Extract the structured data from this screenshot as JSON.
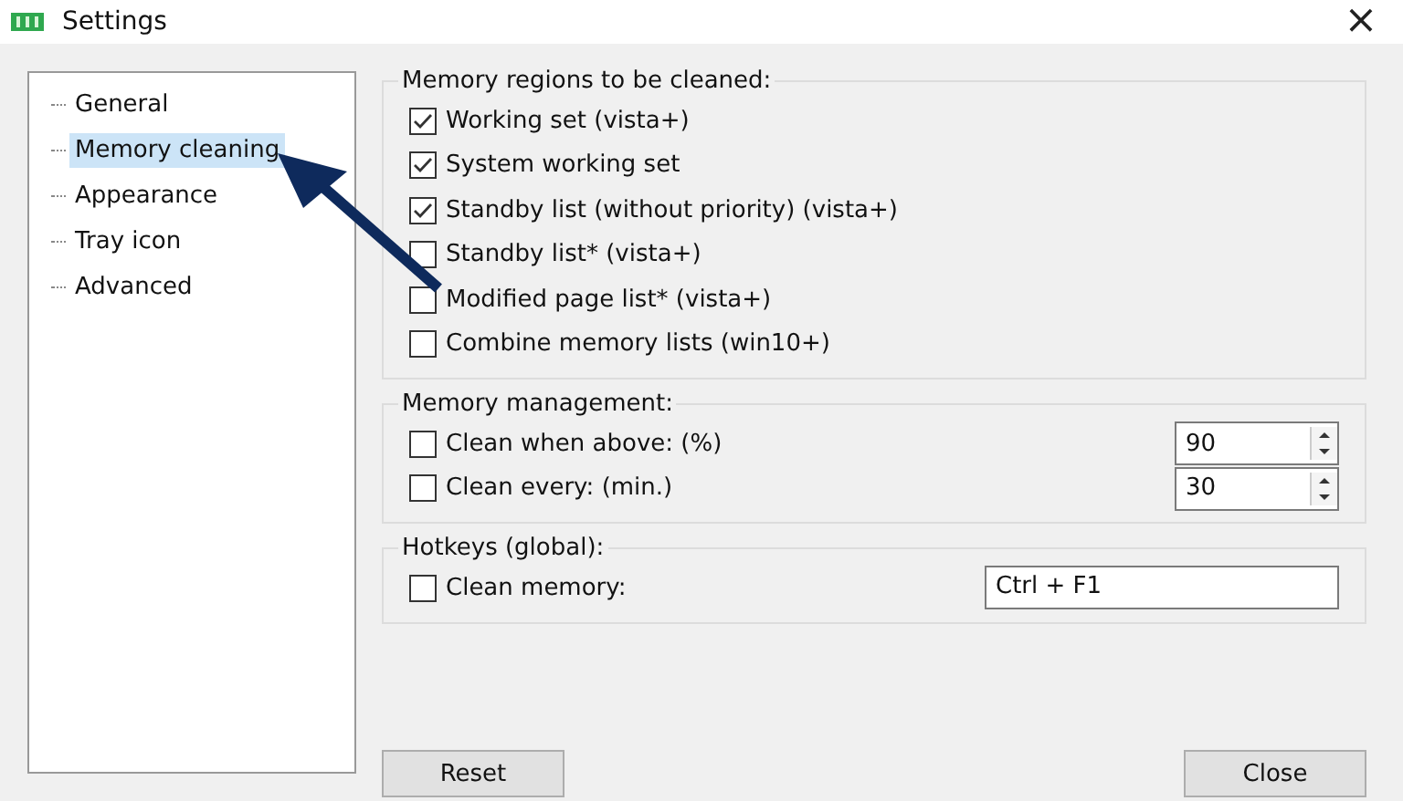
{
  "window": {
    "title": "Settings",
    "close": "×"
  },
  "sidebar": {
    "items": [
      {
        "label": "General",
        "selected": false
      },
      {
        "label": "Memory cleaning",
        "selected": true
      },
      {
        "label": "Appearance",
        "selected": false
      },
      {
        "label": "Tray icon",
        "selected": false
      },
      {
        "label": "Advanced",
        "selected": false
      }
    ]
  },
  "regions": {
    "title": "Memory regions to be cleaned:",
    "options": [
      {
        "label": "Working set (vista+)",
        "checked": true
      },
      {
        "label": "System working set",
        "checked": true
      },
      {
        "label": "Standby list (without priority) (vista+)",
        "checked": true
      },
      {
        "label": "Standby list* (vista+)",
        "checked": false
      },
      {
        "label": "Modified page list* (vista+)",
        "checked": false
      },
      {
        "label": "Combine memory lists (win10+)",
        "checked": false
      }
    ]
  },
  "management": {
    "title": "Memory management:",
    "options": [
      {
        "label": "Clean when above: (%)",
        "checked": false,
        "value": "90"
      },
      {
        "label": "Clean every: (min.)",
        "checked": false,
        "value": "30"
      }
    ]
  },
  "hotkeys": {
    "title": "Hotkeys (global):",
    "options": [
      {
        "label": "Clean memory:",
        "checked": false,
        "value": "Ctrl + F1"
      }
    ]
  },
  "buttons": [
    "Reset",
    "Close"
  ],
  "annotation": {
    "kind": "arrow"
  }
}
